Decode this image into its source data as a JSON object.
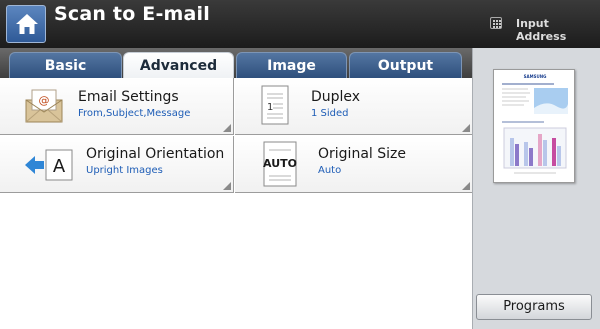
{
  "header": {
    "title": "Scan to E-mail",
    "input_address": "Input Address"
  },
  "tabs": [
    {
      "label": "Basic",
      "active": false
    },
    {
      "label": "Advanced",
      "active": true
    },
    {
      "label": "Image",
      "active": false
    },
    {
      "label": "Output",
      "active": false
    }
  ],
  "settings": {
    "email": {
      "label": "Email Settings",
      "value": "From,Subject,Message",
      "icon": "envelope-icon"
    },
    "duplex": {
      "label": "Duplex",
      "value": "1 Sided",
      "icon": "duplex-page-icon",
      "page_number": "1"
    },
    "orientation": {
      "label": "Original Orientation",
      "value": "Upright Images",
      "icon": "orientation-icon",
      "glyph": "A"
    },
    "size": {
      "label": "Original Size",
      "value": "Auto",
      "icon": "auto-size-icon",
      "glyph": "AUTO"
    }
  },
  "preview": {
    "brand": "SAMSUNG"
  },
  "footer": {
    "programs_label": "Programs"
  },
  "colors": {
    "accent_blue": "#1e5db6",
    "tab_blue": "#2e4f7c"
  }
}
